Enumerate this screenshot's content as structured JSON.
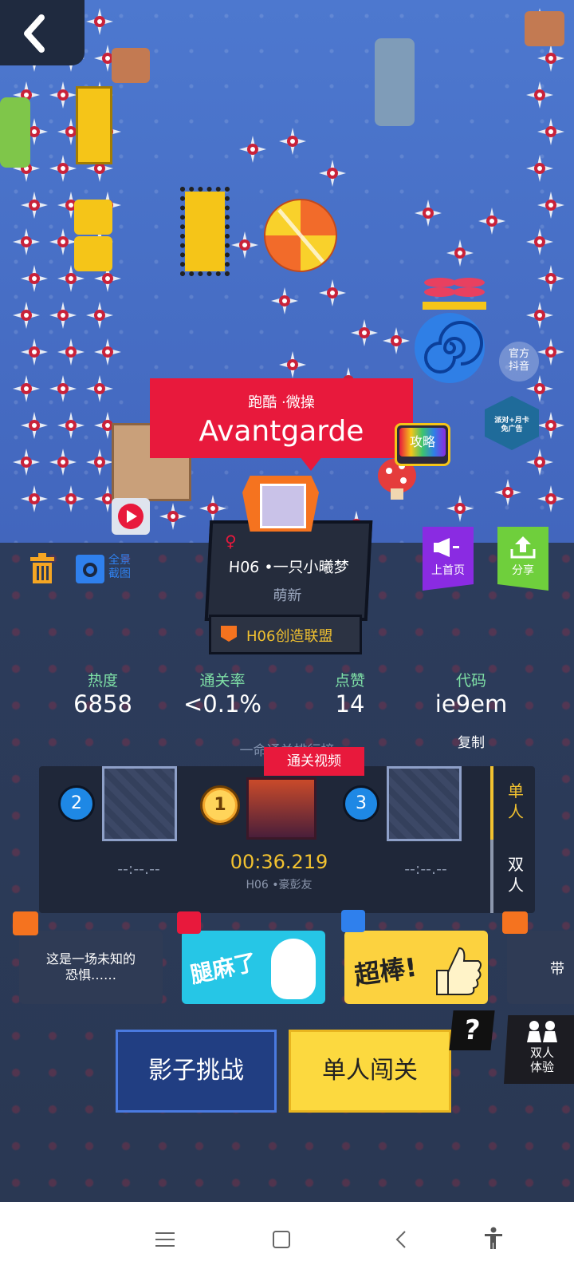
{
  "level": {
    "category": "跑酷 ·微操",
    "name": "Avantgarde",
    "strategy_badge": "攻略",
    "official_label": "官方\n抖音",
    "promo_label": "派对+月卡\n免广告"
  },
  "toolbar": {
    "back_label": "",
    "panorama_label": "全景\n截图",
    "homepage_label": "上首页",
    "share_label": "分享"
  },
  "author": {
    "gender_symbol": "♀",
    "name": "H06 •一只小曦梦",
    "rank": "萌新",
    "guild": "H06创造联盟"
  },
  "stats": [
    {
      "label": "热度",
      "value": "6858"
    },
    {
      "label": "通关率",
      "value": "<0.1%"
    },
    {
      "label": "点赞",
      "value": "14"
    },
    {
      "label": "代码",
      "value": "ie9em"
    }
  ],
  "copy_label": "复制",
  "leaderboard": {
    "title": "一命通关排行榜",
    "video_label": "通关视频",
    "first": {
      "rank": "1",
      "time": "00:36.219",
      "player": "H06 •豪彭友"
    },
    "second": {
      "rank": "2",
      "time": "--:--.--"
    },
    "third": {
      "rank": "3",
      "time": "--:--.--"
    },
    "tab_single": "单\n人",
    "tab_double": "双\n人"
  },
  "comments": [
    {
      "text": "这是一场未知的\n恐惧……"
    },
    {
      "text": "腿麻了"
    },
    {
      "text": "超棒!"
    },
    {
      "text": "带"
    }
  ],
  "actions": {
    "shadow_label": "影子挑战",
    "single_label": "单人闯关",
    "help_label": "?",
    "duo_label": "双人\n体验"
  },
  "colors": {
    "accent_red": "#e8193c",
    "accent_yellow": "#fcd93f",
    "purple": "#8a2be2",
    "green": "#6fcf3c",
    "rank_time": "#f2c230"
  }
}
